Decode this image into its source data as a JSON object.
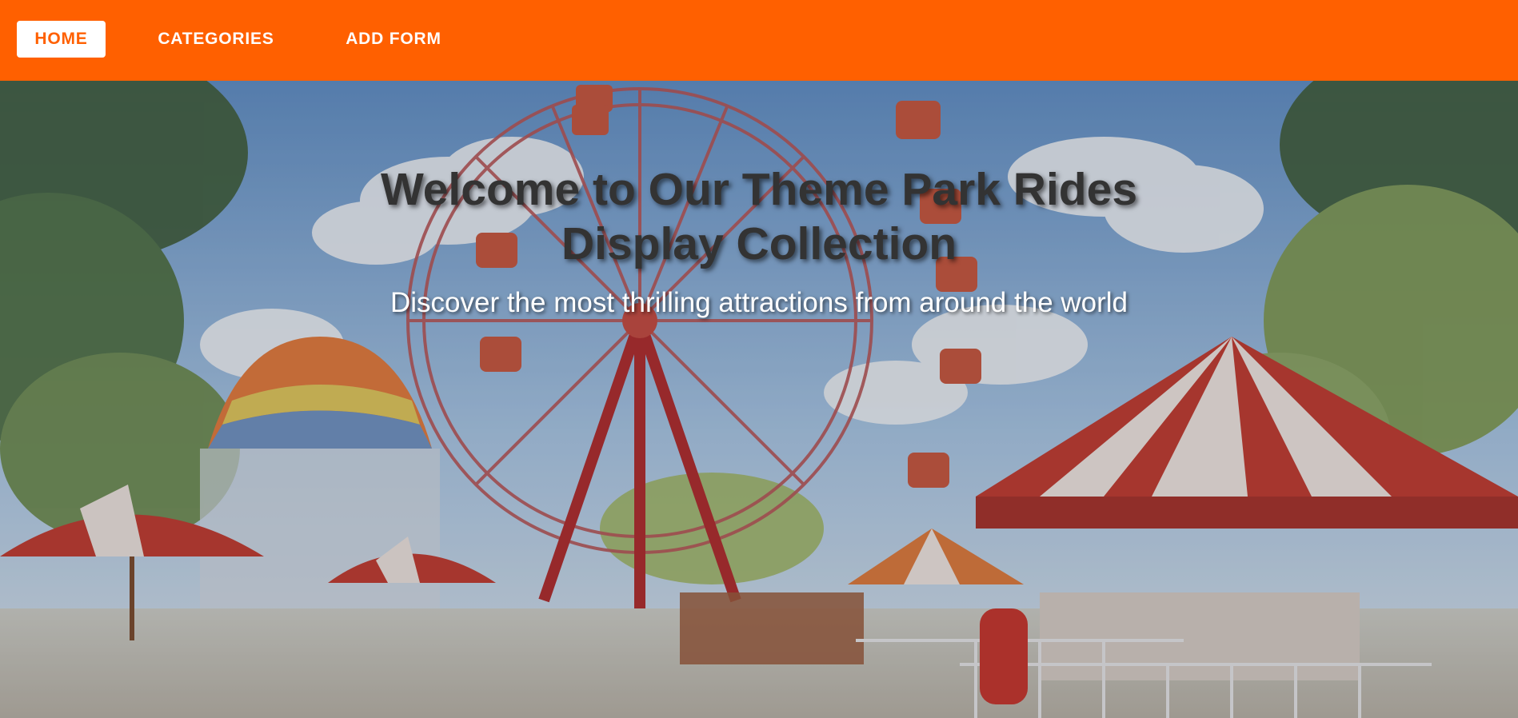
{
  "nav": {
    "items": [
      {
        "label": "HOME",
        "active": true
      },
      {
        "label": "CATEGORIES",
        "active": false
      },
      {
        "label": "ADD FORM",
        "active": false
      }
    ],
    "bg_color": "#ff6000",
    "active_bg_color": "#ffffff"
  },
  "hero": {
    "title": "Welcome to Our Theme Park Rides Display Collection",
    "subtitle": "Discover the most thrilling attractions from around the world",
    "title_color": "#333333",
    "subtitle_color": "#ffffff",
    "background_image": "theme-park-illustration"
  }
}
